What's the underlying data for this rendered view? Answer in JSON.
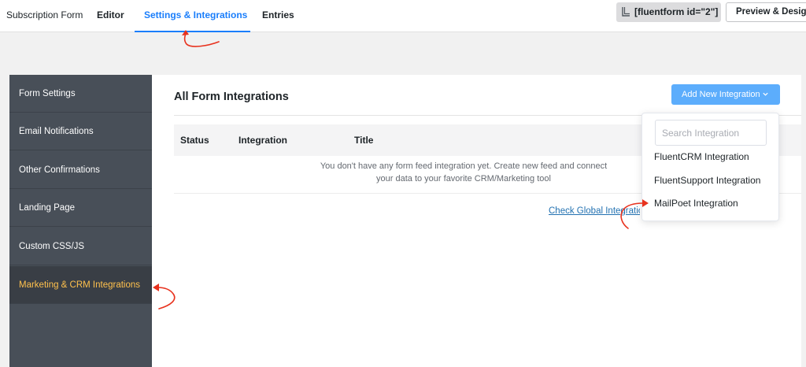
{
  "nav": {
    "tabs": [
      {
        "label": "Subscription Form"
      },
      {
        "label": "Editor"
      },
      {
        "label": "Settings & Integrations"
      },
      {
        "label": "Entries"
      }
    ],
    "shortcode": "[fluentform id=\"2\"]",
    "preview_label": "Preview & Design"
  },
  "sidebar": {
    "items": [
      {
        "label": "Form Settings"
      },
      {
        "label": "Email Notifications"
      },
      {
        "label": "Other Confirmations"
      },
      {
        "label": "Landing Page"
      },
      {
        "label": "Custom CSS/JS"
      },
      {
        "label": "Marketing & CRM Integrations"
      }
    ],
    "active_color": "#ffc14d"
  },
  "main": {
    "title": "All Form Integrations",
    "add_button_label": "Add New Integration",
    "columns": [
      "Status",
      "Integration",
      "Title"
    ],
    "empty_line1": "You don't have any form feed integration yet. Create new feed and connect",
    "empty_line2": "your data to your favorite CRM/Marketing tool",
    "global_link": "Check Global Integrations"
  },
  "dropdown": {
    "search_placeholder": "Search Integration",
    "options": [
      "FluentCRM Integration",
      "FluentSupport Integration",
      "MailPoet Integration"
    ]
  },
  "colors": {
    "accent": "#1a7efb",
    "annotation": "#e8321e",
    "sidebar_bg": "#484f58",
    "button_bg": "#5cadfc"
  }
}
